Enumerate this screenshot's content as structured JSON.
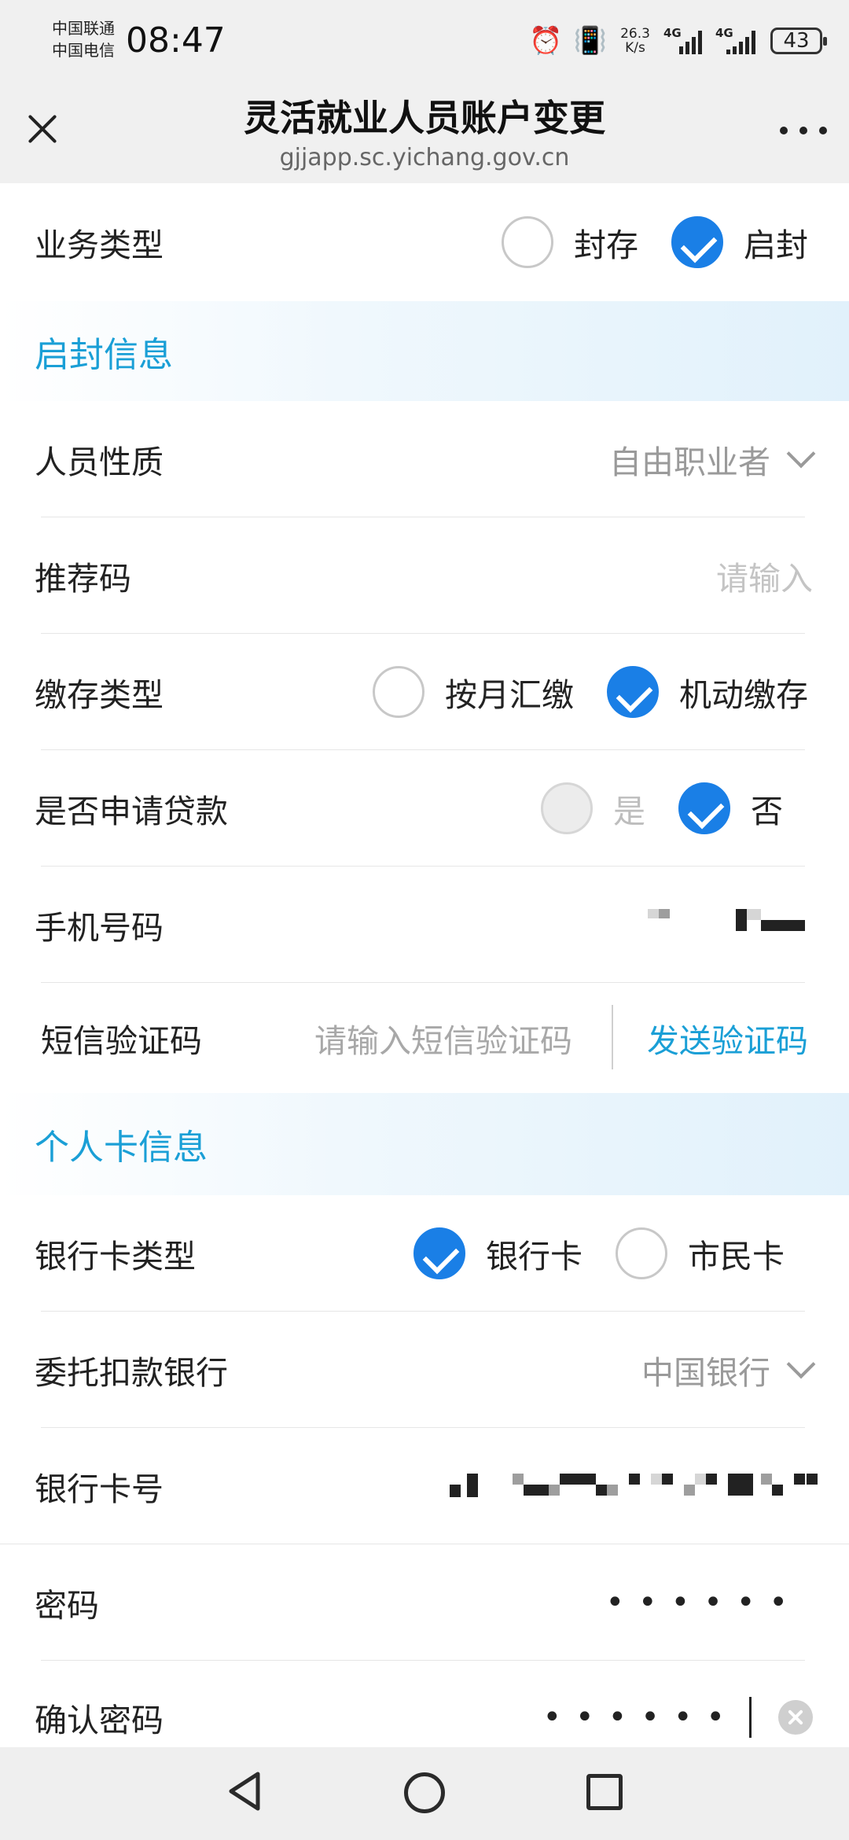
{
  "status_bar": {
    "carrier_1": "中国联通",
    "carrier_2": "中国电信",
    "time": "08:47",
    "net_speed": "26.3",
    "net_speed_unit": "K/s",
    "network_1": "4G",
    "network_2": "4G",
    "battery": "43"
  },
  "header": {
    "title": "灵活就业人员账户变更",
    "url": "gjjapp.sc.yichang.gov.cn"
  },
  "business_type": {
    "label": "业务类型",
    "options": [
      "封存",
      "启封"
    ],
    "selected": "启封"
  },
  "section_unseal": {
    "title": "启封信息"
  },
  "personnel_type": {
    "label": "人员性质",
    "value": "自由职业者"
  },
  "referral_code": {
    "label": "推荐码",
    "placeholder": "请输入"
  },
  "deposit_type": {
    "label": "缴存类型",
    "options": [
      "按月汇缴",
      "机动缴存"
    ],
    "selected": "机动缴存"
  },
  "loan_apply": {
    "label": "是否申请贷款",
    "options": [
      "是",
      "否"
    ],
    "selected": "否"
  },
  "phone": {
    "label": "手机号码"
  },
  "sms_code": {
    "label": "短信验证码",
    "placeholder": "请输入短信验证码",
    "send_label": "发送验证码"
  },
  "section_card": {
    "title": "个人卡信息"
  },
  "card_type": {
    "label": "银行卡类型",
    "options": [
      "银行卡",
      "市民卡"
    ],
    "selected": "银行卡"
  },
  "entrust_bank": {
    "label": "委托扣款银行",
    "value": "中国银行"
  },
  "card_number": {
    "label": "银行卡号"
  },
  "password": {
    "label": "密码",
    "mask": "••••••"
  },
  "confirm_password": {
    "label": "确认密码",
    "mask": "••••••"
  },
  "colors": {
    "accent": "#1a7fe6",
    "section_title": "#1a9fd6"
  }
}
